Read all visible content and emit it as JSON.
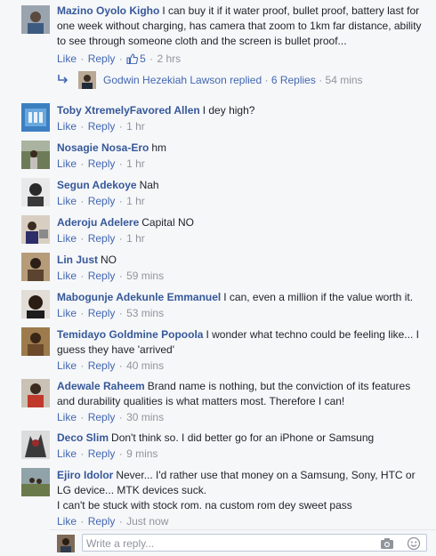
{
  "actions": {
    "like": "Like",
    "reply": "Reply",
    "dot": "·"
  },
  "comments": [
    {
      "name": "Mazino Oyolo Kigho",
      "text": "I can buy it if it water proof, bullet proof, battery last for one week without charging, has camera that zoom to 1km far distance, ability to see through someone cloth and the screen is bullet proof...",
      "time": "2 hrs",
      "likes": "5"
    },
    {
      "name": "Toby XtremelyFavored Allen",
      "text": "I dey high?",
      "time": "1 hr"
    },
    {
      "name": "Nosagie Nosa-Ero",
      "text": "hm",
      "time": "1 hr"
    },
    {
      "name": "Segun Adekoye",
      "text": "Nah",
      "time": "1 hr"
    },
    {
      "name": "Aderoju Adelere",
      "text": "Capital NO",
      "time": "1 hr"
    },
    {
      "name": "Lin Just",
      "text": "NO",
      "time": "59 mins"
    },
    {
      "name": "Mabogunje Adekunle Emmanuel",
      "text": "I can, even a million if the value worth it.",
      "time": "53 mins"
    },
    {
      "name": "Temidayo Goldmine Popoola",
      "text": "I wonder what techno could be feeling like... I guess they have 'arrived'",
      "time": "40 mins"
    },
    {
      "name": "Adewale Raheem",
      "text": "Brand name is nothing, but the conviction of its features and durability qualities is what matters most. Therefore I can!",
      "time": "30 mins"
    },
    {
      "name": "Deco Slim",
      "text": "Don't think so. I did better go for an iPhone or Samsung",
      "time": "9 mins"
    },
    {
      "name": "Ejiro Idolor",
      "text": "Never... I'd rather use that money on a Samsung, Sony, HTC or LG device... MTK devices suck.",
      "text2": "I can't be stuck with stock rom. na custom rom dey sweet pass",
      "time": "Just now"
    }
  ],
  "replies_summary": {
    "name": "Godwin Hezekiah Lawson",
    "action": "replied",
    "count": "6 Replies",
    "time": "54 mins"
  },
  "write_reply": {
    "placeholder": "Write a reply..."
  },
  "colors": {
    "link": "#4267b2",
    "name": "#365899",
    "muted": "#90949c",
    "background": "#f6f7f9"
  }
}
